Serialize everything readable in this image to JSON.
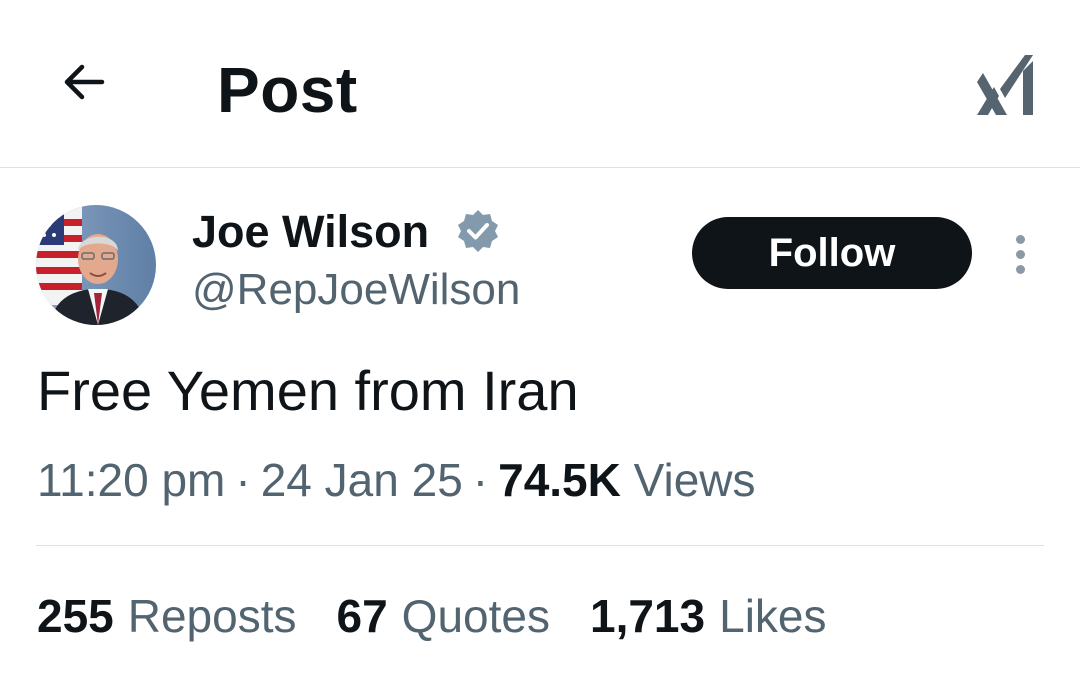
{
  "header": {
    "title": "Post",
    "back_icon": "arrow-left-icon",
    "grok_icon": "grok-icon"
  },
  "author": {
    "name": "Joe Wilson",
    "handle": "@RepJoeWilson",
    "verified": true,
    "verified_color": "#829aab",
    "avatar_icon": "avatar-photo"
  },
  "follow_button": {
    "label": "Follow"
  },
  "more_icon": "more-vertical-icon",
  "tweet": {
    "text": "Free Yemen from Iran",
    "time": "11:20 pm",
    "separator": "·",
    "date": "24 Jan 25",
    "views_count": "74.5K",
    "views_label": "Views"
  },
  "stats": {
    "reposts_count": "255",
    "reposts_label": "Reposts",
    "quotes_count": "67",
    "quotes_label": "Quotes",
    "likes_count": "1,713",
    "likes_label": "Likes"
  },
  "colors": {
    "text_primary": "#0f1419",
    "text_secondary": "#536471",
    "border": "#dde2e6",
    "button_bg": "#0f1419",
    "button_text": "#ffffff"
  }
}
